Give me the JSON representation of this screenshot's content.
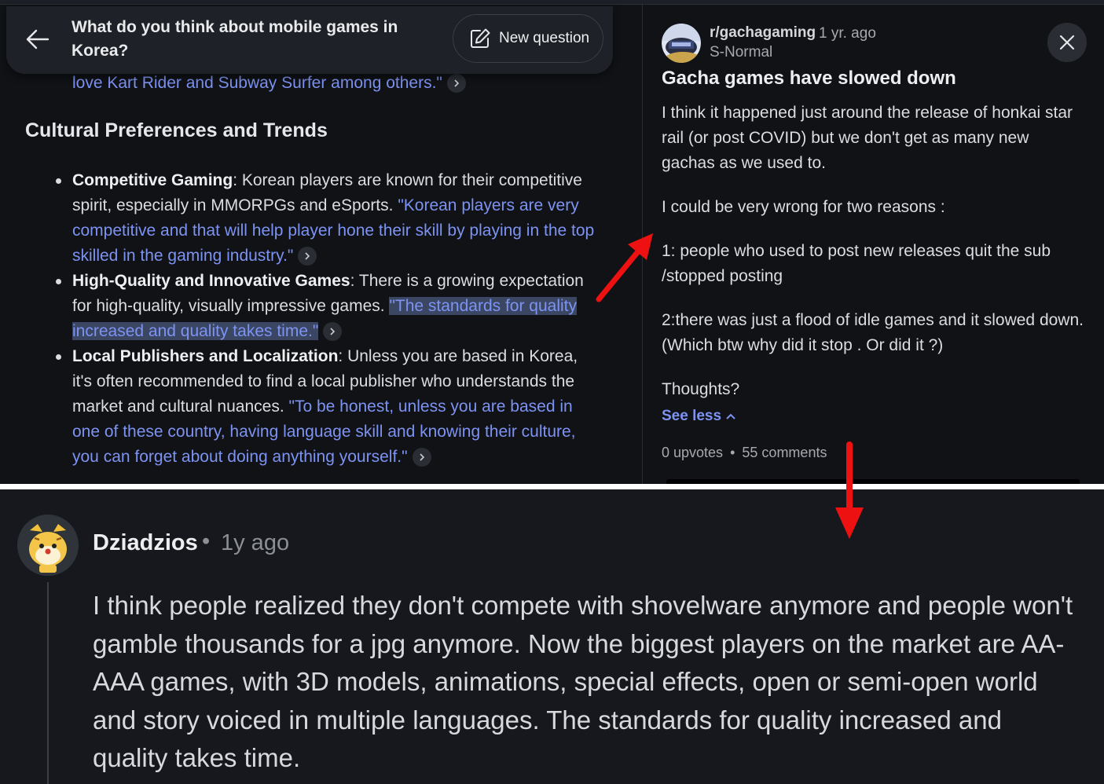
{
  "question": {
    "title": "What do you think about mobile games in Korea?",
    "new_question_label": "New question"
  },
  "answer": {
    "quote_line": "love Kart Rider and Subway Surfer among others.\"",
    "section_heading": "Cultural Preferences and Trends",
    "bullets": [
      {
        "lead": "Competitive Gaming",
        "text": ": Korean players are known for their competitive spirit, especially in MMORPGs and eSports. ",
        "quote": "\"Korean players are very competitive and that will help player hone their skill by playing in the top skilled in the gaming industry.\""
      },
      {
        "lead": "High-Quality and Innovative Games",
        "text": ": There is a growing expectation for high-quality, visually impressive games. ",
        "quote": "\"The standards for quality increased and quality takes time.\""
      },
      {
        "lead": "Local Publishers and Localization",
        "text": ": Unless you are based in Korea, it's often recommended to find a local publisher who understands the market and cultural nuances. ",
        "quote": "\"To be honest, unless you are based in one of these country, having language skill and knowing their culture, you can forget about doing anything yourself.\""
      }
    ]
  },
  "post": {
    "subreddit": "r/gachagaming",
    "age": "1 yr. ago",
    "flair": "S-Normal",
    "title": "Gacha games have slowed down",
    "paragraphs": [
      "I think it happened just around the release of honkai star rail (or post COVID) but we don't get as many new gachas as we used to.",
      "I could be very wrong for two reasons :",
      "1: people who used to post new releases quit the sub /stopped posting",
      "2:there was just a flood of idle games and it slowed down. (Which btw why did it stop . Or did it ?)",
      "Thoughts?"
    ],
    "see_less": "See less",
    "upvotes": "0 upvotes",
    "stats_separator": "•",
    "comments": "55 comments"
  },
  "comment": {
    "author": "Dziadzios",
    "separator": "•",
    "age": "1y ago",
    "text": "I think people realized they don't compete with shovelware anymore and people won't gamble thousands for a jpg anymore. Now the biggest players on the market are AA-AAA games, with 3D models, animations, special effects, open or semi-open world and story voiced in multiple languages. The standards for quality increased and quality takes time."
  },
  "colors": {
    "link": "#7d93f2",
    "highlight": "#3b4663",
    "arrow": "#ee1111",
    "panel": "#101216",
    "comment_bg": "#16181d"
  },
  "icons": [
    "back-arrow-icon",
    "edit-icon",
    "chevron-right-icon",
    "close-icon",
    "chevron-up-icon",
    "subreddit-avatar-icon",
    "user-avatar-icon"
  ]
}
